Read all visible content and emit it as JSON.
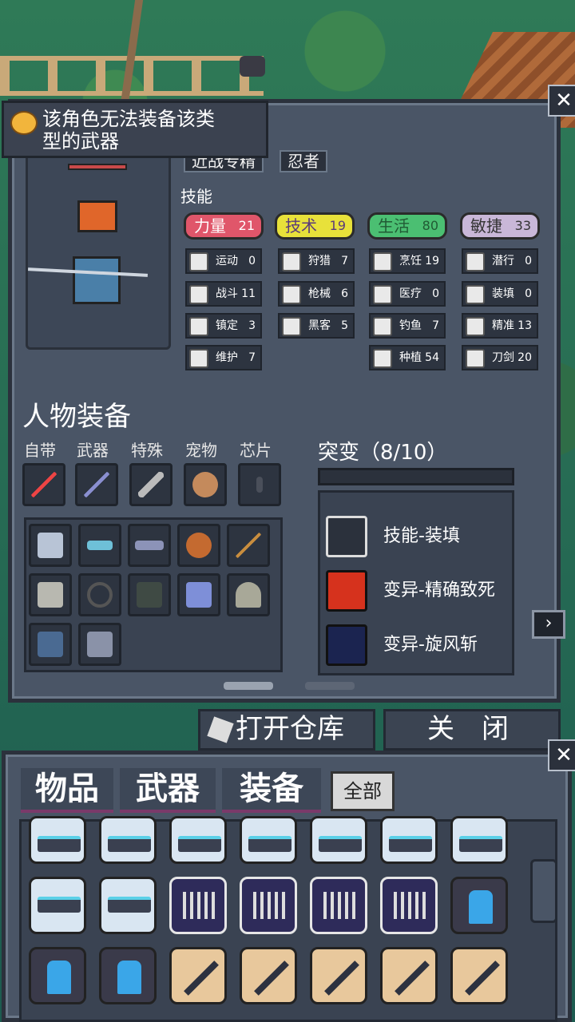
{
  "tooltip": {
    "text_line1": "该角色无法装备该类",
    "text_line2": "型的武器"
  },
  "character": {
    "tags": [
      "近战专精",
      "忍者"
    ]
  },
  "skills_label": "技能",
  "stats": [
    {
      "name": "力量",
      "value": "21",
      "color": "#e0566a"
    },
    {
      "name": "技术",
      "value": "19",
      "color": "#e8e13a"
    },
    {
      "name": "生活",
      "value": "80",
      "color": "#4bbf72"
    },
    {
      "name": "敏捷",
      "value": "33",
      "color": "#c9b7d8"
    }
  ],
  "skills": [
    {
      "name": "运动",
      "value": "0"
    },
    {
      "name": "狩猎",
      "value": "7"
    },
    {
      "name": "烹饪",
      "value": "19"
    },
    {
      "name": "潜行",
      "value": "0"
    },
    {
      "name": "战斗",
      "value": "11"
    },
    {
      "name": "枪械",
      "value": "6"
    },
    {
      "name": "医疗",
      "value": "0"
    },
    {
      "name": "装填",
      "value": "0"
    },
    {
      "name": "镇定",
      "value": "3"
    },
    {
      "name": "黑客",
      "value": "5"
    },
    {
      "name": "钓鱼",
      "value": "7"
    },
    {
      "name": "精准",
      "value": "13"
    },
    {
      "name": "维护",
      "value": "7"
    },
    {
      "name": "种植",
      "value": "54"
    },
    {
      "name": "刀剑",
      "value": "20"
    }
  ],
  "equipment": {
    "title": "人物装备",
    "slot_labels": [
      "自带",
      "武器",
      "特殊",
      "宠物",
      "芯片"
    ]
  },
  "mutations": {
    "title": "突变（8/10）",
    "items": [
      "技能-装填",
      "变异-精确致死",
      "变异-旋风斩"
    ]
  },
  "buttons": {
    "open_storage": "打开仓库",
    "close": "关　闭",
    "close_x": "✕"
  },
  "tabs": {
    "items": "物品",
    "weapons": "武器",
    "equipment": "装备",
    "all": "全部"
  }
}
